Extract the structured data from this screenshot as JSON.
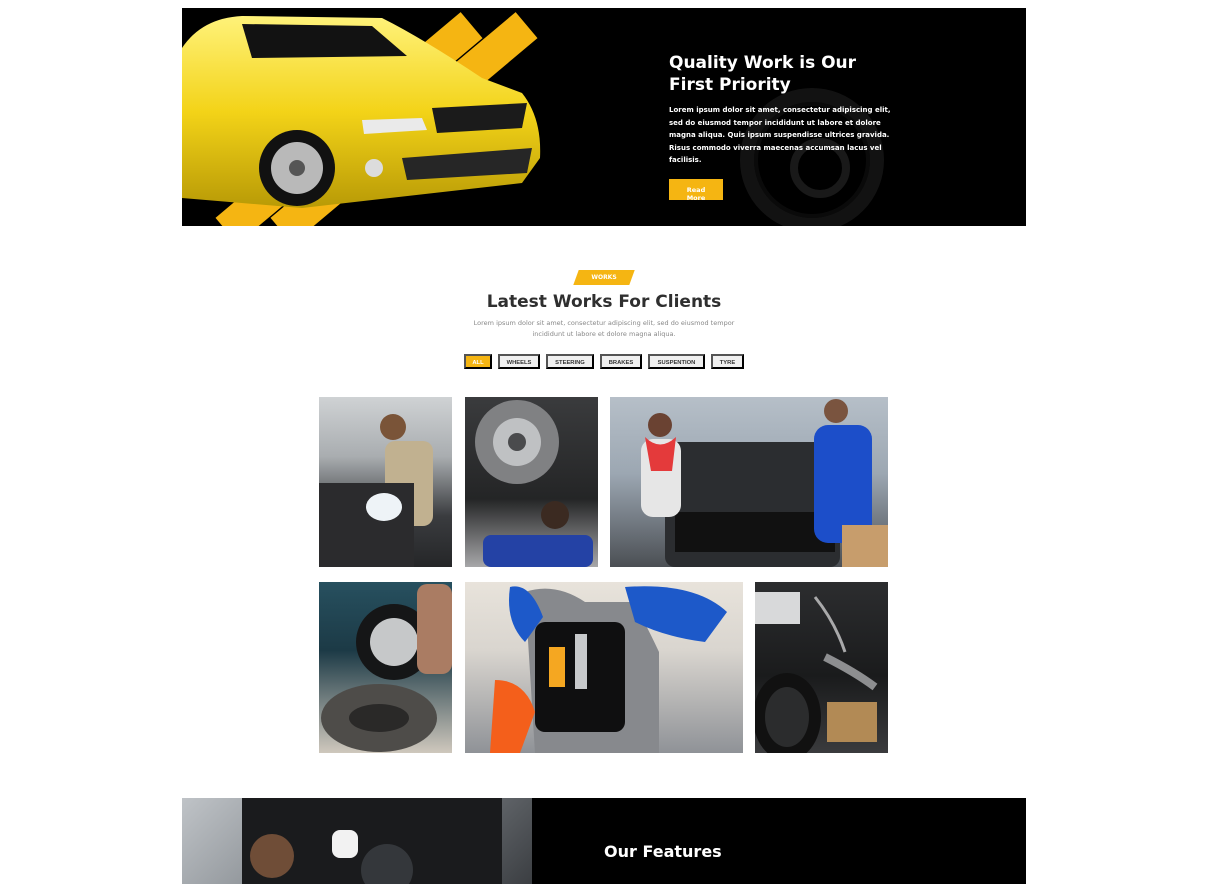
{
  "hero": {
    "title": "Quality Work is Our First Priority",
    "body": "Lorem ipsum dolor sit amet, consectetur adipiscing elit, sed do eiusmod tempor incididunt ut labore et dolore magna aliqua. Quis ipsum suspendisse ultrices gravida. Risus commodo viverra maecenas accumsan lacus vel facilisis.",
    "button": "Read More"
  },
  "works": {
    "tag": "WORKS",
    "title": "Latest Works For Clients",
    "subtitle": "Lorem ipsum dolor sit amet, consectetur adipiscing elit, sed do eiusmod tempor incididunt ut labore et dolore magna aliqua.",
    "filters": [
      "ALL",
      "WHEELS",
      "STEERING",
      "BRAKES",
      "SUSPENTION",
      "TYRE"
    ],
    "active_filter": "ALL"
  },
  "features": {
    "title": "Our Features"
  },
  "colors": {
    "accent": "#f5b512",
    "dark": "#000000"
  }
}
